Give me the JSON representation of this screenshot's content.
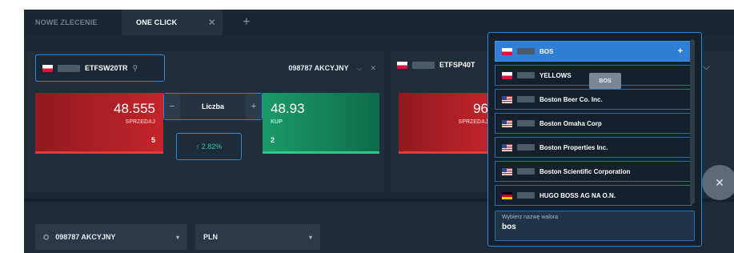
{
  "tabs": [
    {
      "label": "NOWE ZLECENIE"
    },
    {
      "label": "ONE CLICK",
      "close": "✕"
    }
  ],
  "add_tab": "+",
  "panel1": {
    "symbol": "ETFSW20TR",
    "account": "098787 AKCYJNY",
    "chevron": "⌵",
    "close": "✕",
    "sell": {
      "price": "48.555",
      "label": "SPRZEDAJ",
      "qty": "5"
    },
    "buy": {
      "price": "48.93",
      "label": "KUP",
      "qty": "2"
    },
    "quantity": {
      "minus": "−",
      "label": "Liczba",
      "plus": "+"
    },
    "change": "↑ 2.82%"
  },
  "panel2": {
    "symbol": "ETFSP40T",
    "chevron": "⌵",
    "sell": {
      "price": "96",
      "label": "SPRZEDAJ"
    }
  },
  "bottom": {
    "account_select": "098787 AKCYJNY",
    "currency_select": "PLN",
    "chevron": "▾"
  },
  "dropdown": {
    "items": [
      {
        "name": "BOS",
        "flag": "pl"
      },
      {
        "name": "YELLOWS",
        "flag": "pl"
      },
      {
        "name": "Boston Beer Co. Inc.",
        "flag": "us"
      },
      {
        "name": "Boston Omaha Corp",
        "flag": "us"
      },
      {
        "name": "Boston Properties Inc.",
        "flag": "us"
      },
      {
        "name": "Boston Scientific Corporation",
        "flag": "us"
      },
      {
        "name": "HUGO BOSS AG NA O.N.",
        "flag": "de"
      }
    ],
    "plus": "+",
    "tooltip": "BOS",
    "search_label": "Wybierz nazwę walora",
    "search_value": "bos"
  },
  "fab": "✕",
  "colors": {
    "accent": "#2b87d9",
    "sell": "#c4242b",
    "buy": "#1b9a69",
    "up": "#35c89a"
  }
}
